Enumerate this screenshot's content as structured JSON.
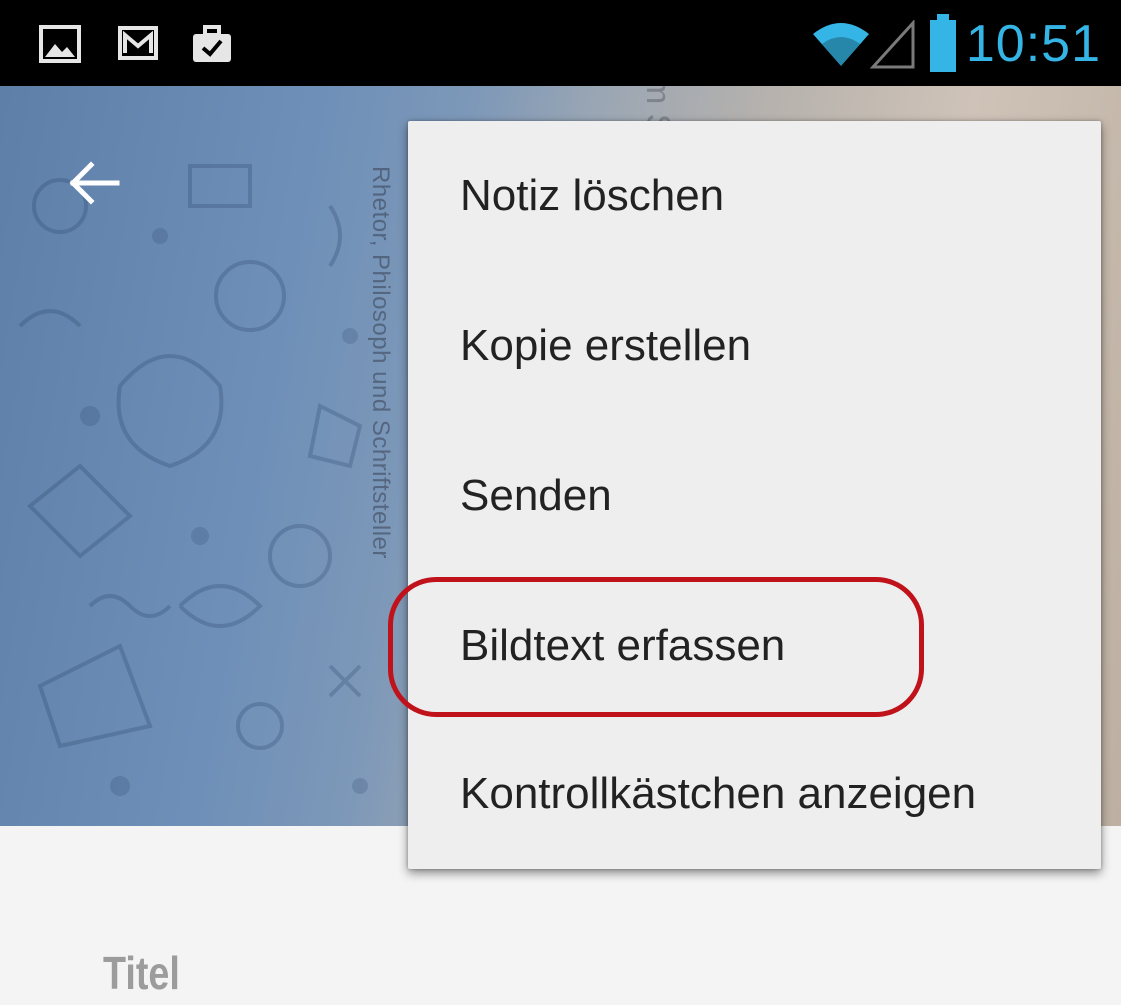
{
  "status_bar": {
    "time": "10:51",
    "notification_icons": [
      "gallery-icon",
      "gmail-icon",
      "briefcase-check-icon"
    ],
    "system_icons": [
      "wifi-icon",
      "cell-signal-icon",
      "battery-icon"
    ],
    "accent_color": "#34b5e5"
  },
  "header": {
    "back_icon": "arrow-left-icon",
    "photo_text_1": "Rhetor, Philosoph und Schriftsteller",
    "photo_text_2": "m Sc r.n"
  },
  "menu": {
    "items": [
      {
        "label": "Notiz löschen"
      },
      {
        "label": "Kopie erstellen"
      },
      {
        "label": "Senden"
      },
      {
        "label": "Bildtext erfassen",
        "highlighted": true
      },
      {
        "label": "Kontrollkästchen anzeigen"
      }
    ],
    "highlight_color": "#c0121a"
  },
  "note": {
    "title_placeholder": "Titel"
  }
}
